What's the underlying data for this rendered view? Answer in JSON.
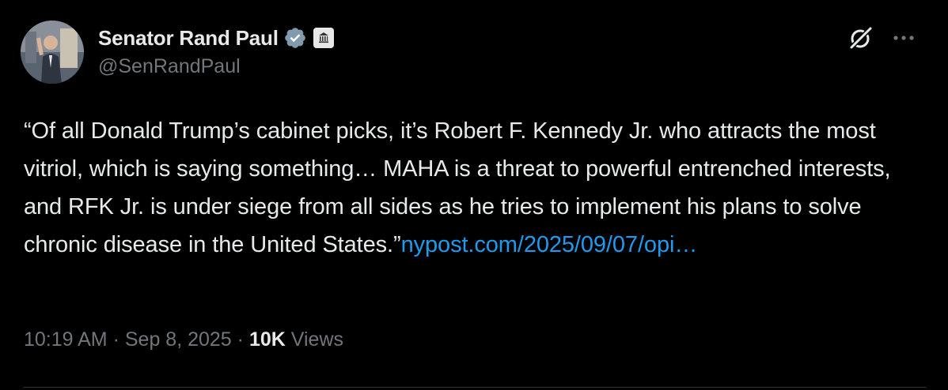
{
  "author": {
    "display_name": "Senator Rand Paul",
    "handle": "@SenRandPaul",
    "verified_icon": "verified-badge-icon",
    "affiliation_icon": "government-building-icon"
  },
  "actions": {
    "grok_icon": "grok-icon",
    "more_icon": "more-options-icon"
  },
  "tweet": {
    "text": "“Of all Donald Trump’s cabinet picks, it’s Robert F. Kennedy Jr. who attracts the most vitriol, which is saying something… MAHA is a threat to powerful entrenched interests, and RFK Jr. is under siege from all sides as he tries to implement his plans to solve chronic disease in the United States.”",
    "link": "nypost.com/2025/09/07/opi…"
  },
  "meta": {
    "time": "10:19 AM",
    "separator": "·",
    "date": "Sep 8, 2025",
    "views_count": "10K",
    "views_label": "Views"
  },
  "colors": {
    "background": "#000000",
    "text": "#e7e9ea",
    "secondary": "#71767b",
    "link": "#1d9bf0",
    "verified": "#829aab"
  }
}
